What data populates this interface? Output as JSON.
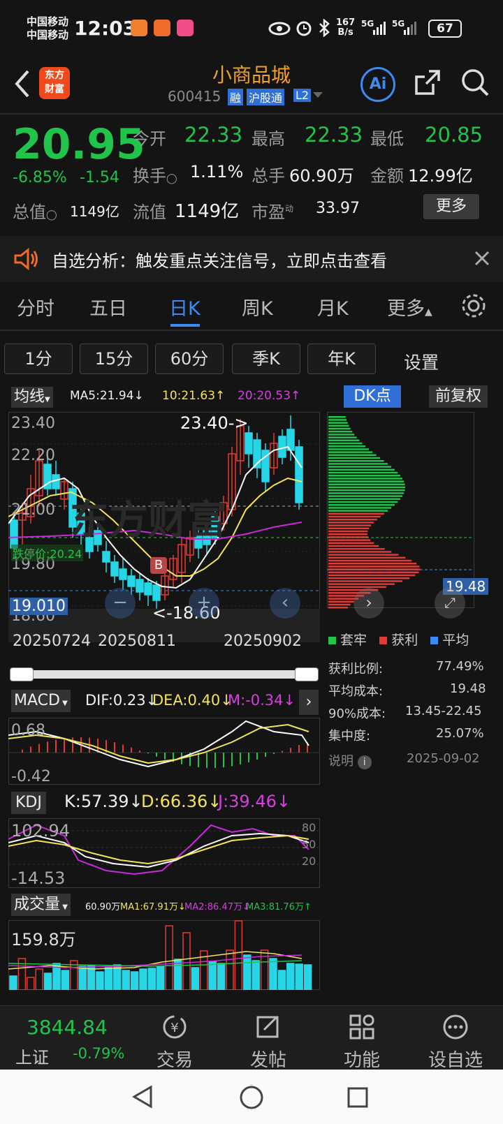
{
  "status_bar": {
    "carrier1": "中国移动",
    "carrier2": "中国移动",
    "time": "12:03",
    "net_speed_top": "167",
    "net_speed_bot": "B/s",
    "sig1": "5G",
    "sig2": "5G",
    "battery": "67"
  },
  "header": {
    "logo_top": "东方",
    "logo_bot": "财富",
    "title": "小商品城",
    "code": "600415",
    "tag_rong": "融",
    "tag_hgt": "沪股通",
    "tag_l2": "L2",
    "ai_label": "Ai"
  },
  "quote": {
    "price": "20.95",
    "change_pct": "-6.85%",
    "change": "-1.54",
    "open_label": "今开",
    "open": "22.33",
    "high_label": "最高",
    "high": "22.33",
    "low_label": "最低",
    "low": "20.85",
    "turnover_label": "换手",
    "turnover": "1.11%",
    "vol_label": "总手",
    "vol": "60.90万",
    "amount_label": "金额",
    "amount": "12.99亿",
    "mcap_label": "总值",
    "mcap": "1149亿",
    "float_label": "流值",
    "float": "1149亿",
    "pe_label": "市盈",
    "pe_sup": "动",
    "pe": "33.97",
    "more": "更多"
  },
  "notice": {
    "text": "自选分析：触发重点关注信号，立即点击查看"
  },
  "tabs": [
    "分时",
    "五日",
    "日K",
    "周K",
    "月K",
    "更多"
  ],
  "subtabs": [
    "1分",
    "15分",
    "60分",
    "季K",
    "年K",
    "设置"
  ],
  "ma_bar": {
    "label": "均线",
    "ma5": "MA5:21.94↓",
    "ma10": "10:21.63↑",
    "ma20": "20:20.53↑",
    "dk": "DK点",
    "fq": "前复权"
  },
  "kline": {
    "y_labels": [
      "23.40",
      "22.20",
      "21.00",
      "19.80",
      "18.60"
    ],
    "high_note": "23.40->",
    "low_note": "<-18.60",
    "limit_down": "跌停价:20.24",
    "cross_price": "19.010",
    "dates": [
      "20250724",
      "20250811",
      "20250902"
    ],
    "b_marker": "B",
    "watermark": "东方财富"
  },
  "chip_panel": {
    "avg_tag": "19.48",
    "legend": [
      "套牢",
      "获利",
      "平均"
    ],
    "stats": [
      {
        "label": "获利比例:",
        "value": "77.49%"
      },
      {
        "label": "平均成本:",
        "value": "19.48"
      },
      {
        "label": "90%成本:",
        "value": "13.45-22.45"
      },
      {
        "label": "集中度:",
        "value": "25.07%"
      }
    ],
    "note_label": "说明",
    "date": "2025-09-02"
  },
  "macd": {
    "label": "MACD",
    "dif": "DIF:0.23↓",
    "dea": "DEA:0.40↓",
    "m": "M:-0.34↓",
    "top": "0.68",
    "bot": "-0.42"
  },
  "kdj": {
    "label": "KDJ",
    "k": "K:57.39↓",
    "d": "D:66.36↓",
    "j": "J:39.46↓",
    "top": "102.94",
    "bot": "-14.53",
    "r80": "80",
    "r50": "50",
    "r20": "20"
  },
  "volume": {
    "label": "成交量",
    "v": "60.90万",
    "ma1": "MA1:67.91万↓",
    "ma2": "MA2:86.47万↓",
    "ma3": "MA3:81.76万↑",
    "top": "159.8万"
  },
  "bottom_nav": {
    "index_value": "3844.84",
    "index_name": "上证",
    "index_change": "-0.79%",
    "items": [
      "交易",
      "发帖",
      "功能",
      "设自选"
    ]
  },
  "colors": {
    "up": "#e53935",
    "down": "#21c44a",
    "candle_down": "#27d6e6",
    "ma5": "#ffffff",
    "ma10": "#f3e35a",
    "ma20": "#c72bd6",
    "accent": "#3d8bf0"
  }
}
